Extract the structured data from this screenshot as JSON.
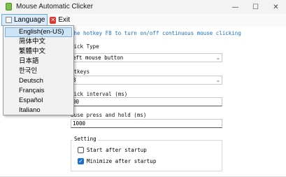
{
  "window": {
    "title": "Mouse Automatic Clicker",
    "controls": {
      "minimize": "—",
      "maximize": "☐",
      "close": "✕"
    }
  },
  "menubar": {
    "language_label": "Language",
    "exit_label": "Exit"
  },
  "language_menu": {
    "items": [
      {
        "label": "English(en-US)",
        "selected": true
      },
      {
        "label": "简体中文",
        "selected": false
      },
      {
        "label": "繁體中文",
        "selected": false
      },
      {
        "label": "日本語",
        "selected": false
      },
      {
        "label": "한국인",
        "selected": false
      },
      {
        "label": "Deutsch",
        "selected": false
      },
      {
        "label": "Français",
        "selected": false
      },
      {
        "label": "Español",
        "selected": false
      },
      {
        "label": "Italiano",
        "selected": false
      }
    ]
  },
  "main": {
    "hint_visible": "the hotkey F8 to turn on/off continuous mouse clicking",
    "click_type": {
      "label_visible": "lick Type",
      "value_visible": "eft mouse button"
    },
    "hotkeys": {
      "label_visible": "otkeys",
      "value_visible": "8"
    },
    "interval": {
      "label_visible": "lick interval (ms)",
      "value_visible": "00"
    },
    "hold": {
      "label_visible": "ouse press and hold (ms)",
      "value": "1000"
    },
    "setting": {
      "title": "Setting",
      "start_after_startup": {
        "label": "Start after startup",
        "checked": false
      },
      "minimize_after_startup": {
        "label": "Minimize after startup",
        "checked": true
      }
    }
  },
  "colors": {
    "accent": "#1a6fd3",
    "hint": "#1b6fc7",
    "exit_icon": "#e3352f",
    "menu_highlight": "#dcebfa"
  }
}
